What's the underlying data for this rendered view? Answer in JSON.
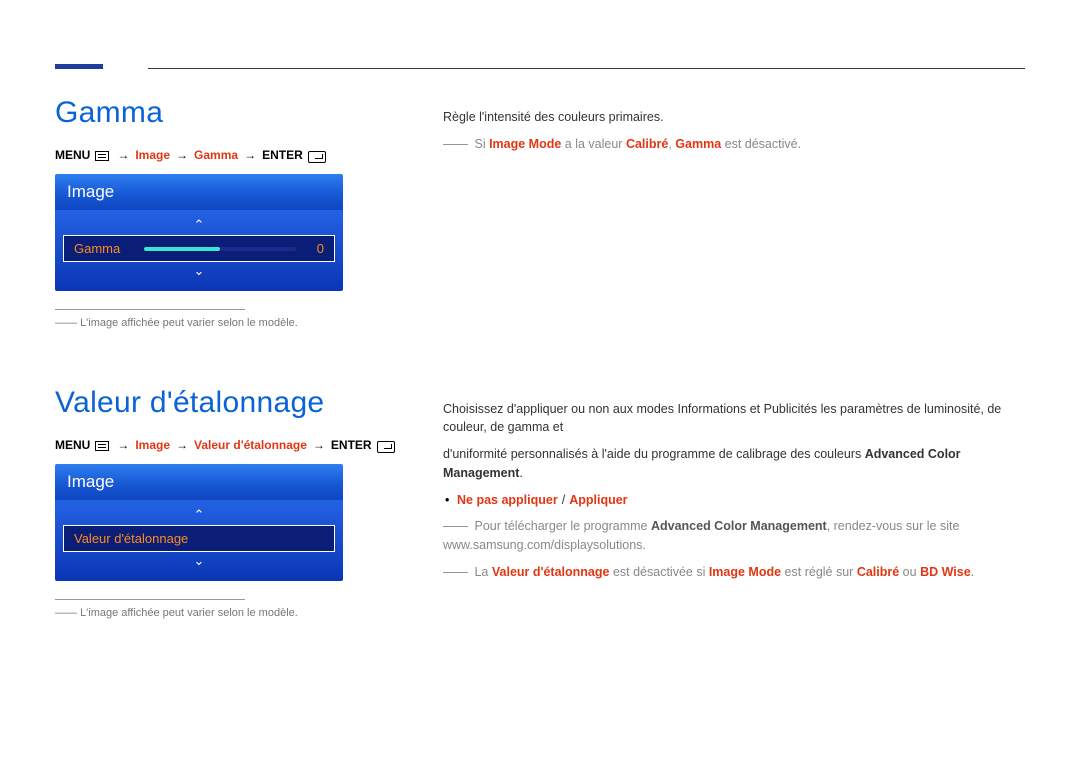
{
  "section1": {
    "title": "Gamma",
    "menu_path": {
      "menu_word": "MENU",
      "image": "Image",
      "target": "Gamma",
      "enter_word": "ENTER",
      "arrow": "→"
    },
    "osd": {
      "header": "Image",
      "row_label": "Gamma",
      "value": "0"
    },
    "footnote_prefix": "――",
    "footnote": "L'image affichée peut varier selon le modèle.",
    "desc1": "Règle l'intensité des couleurs primaires.",
    "note1": {
      "dash": "――",
      "pre": "Si ",
      "image_mode": "Image Mode",
      "mid1": " a la valeur ",
      "calibre": "Calibré",
      "comma": ", ",
      "gamma": "Gamma",
      "post": " est désactivé."
    }
  },
  "section2": {
    "title": "Valeur d'étalonnage",
    "menu_path": {
      "menu_word": "MENU",
      "image": "Image",
      "target": "Valeur d'étalonnage",
      "enter_word": "ENTER",
      "arrow": "→"
    },
    "osd": {
      "header": "Image",
      "row_label": "Valeur d'étalonnage"
    },
    "footnote_prefix": "――",
    "footnote": "L'image affichée peut varier selon le modèle.",
    "desc_line1": "Choisissez d'appliquer ou non aux modes Informations et Publicités les paramètres de luminosité, de couleur, de gamma et",
    "desc_line2_pre": "d'uniformité personnalisés à l'aide du programme de calibrage des couleurs ",
    "desc_line2_bold": "Advanced Color Management",
    "desc_line2_post": ".",
    "bullet": {
      "opt1": "Ne pas appliquer",
      "slash": "/",
      "opt2": "Appliquer"
    },
    "note_download": {
      "dash": "――",
      "pre": "Pour télécharger le programme ",
      "prog": "Advanced Color Management",
      "mid": ", rendez-vous sur le site ",
      "url": "www.samsung.com/displaysolutions",
      "post": "."
    },
    "note_disabled": {
      "dash": "――",
      "pre": "La ",
      "val": "Valeur d'étalonnage",
      "mid1": " est désactivée si ",
      "imode": "Image Mode",
      "mid2": " est réglé sur ",
      "cal": "Calibré",
      "or": " ou ",
      "bd": "BD Wise",
      "post": "."
    }
  }
}
